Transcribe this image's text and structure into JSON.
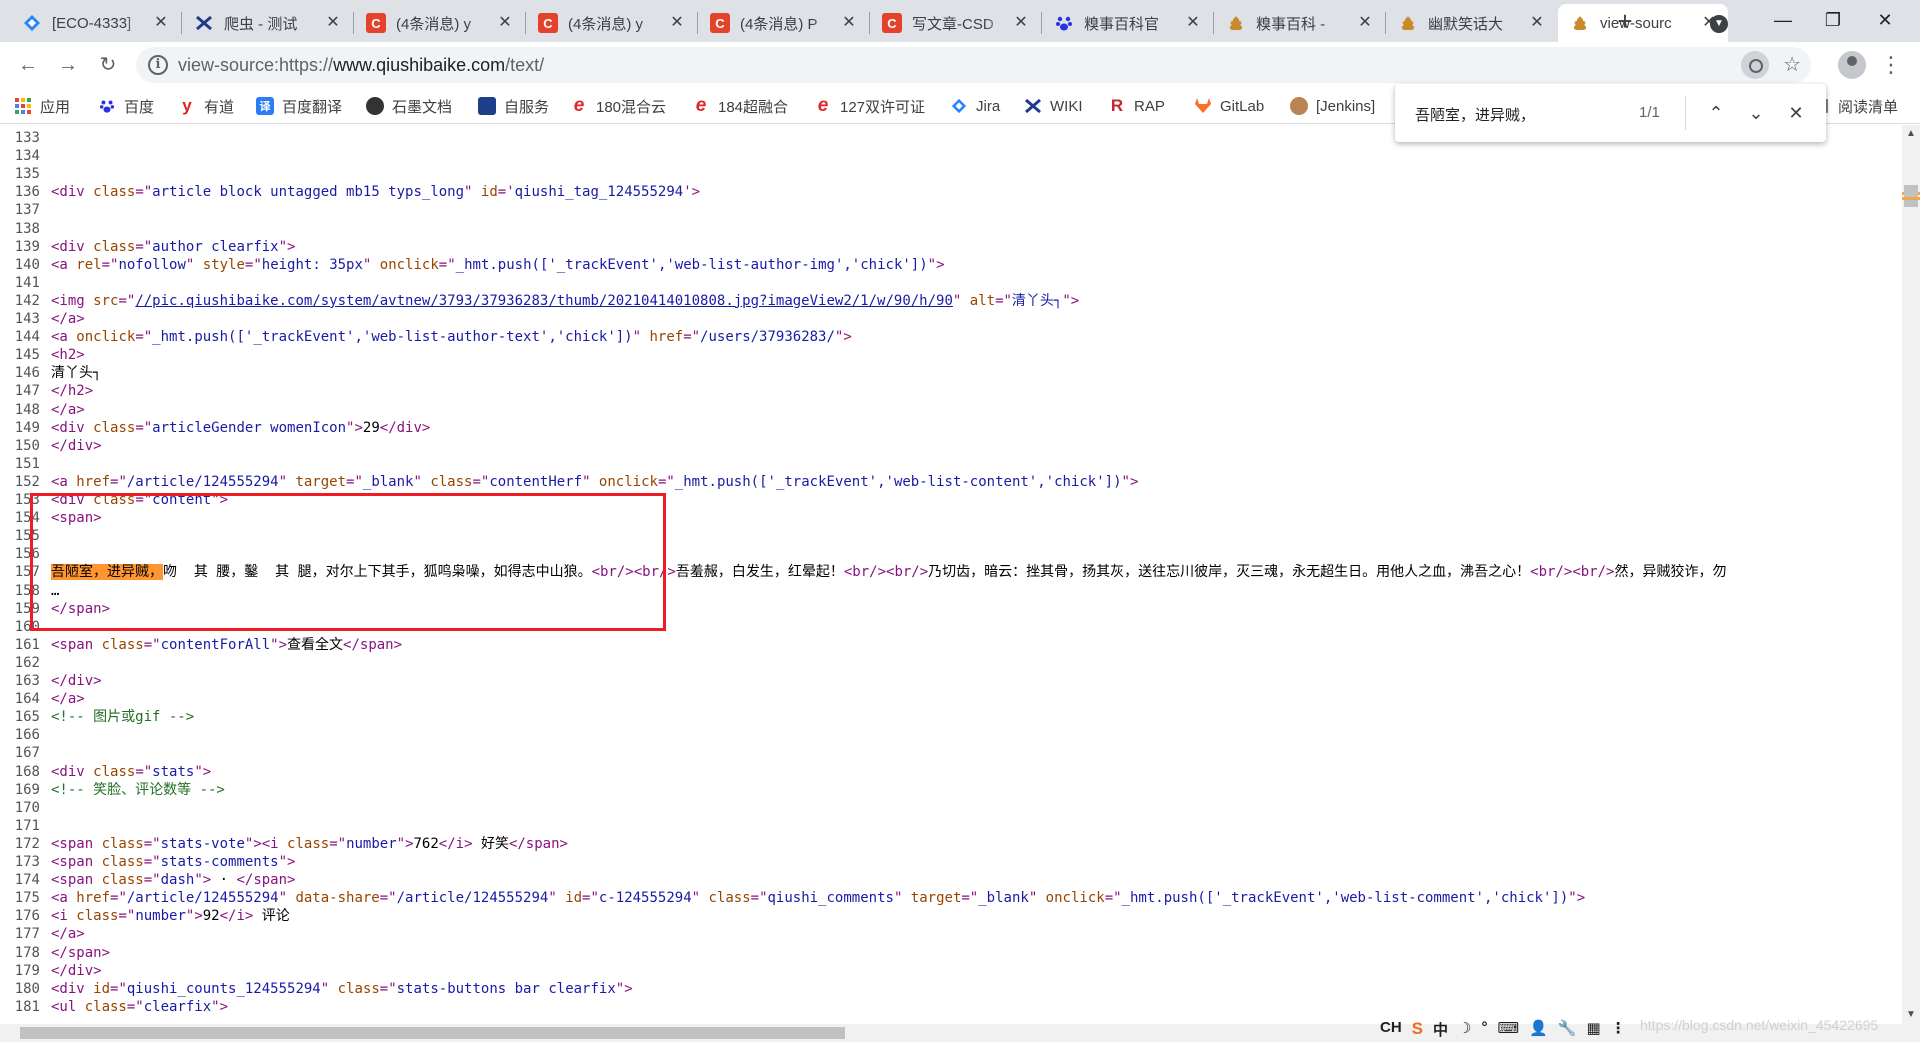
{
  "tabs": [
    {
      "title": "[ECO-4333]",
      "icon": "jira-diamond-icon",
      "color": "#2684ff"
    },
    {
      "title": "爬虫 - 测试",
      "icon": "crawler-x-icon",
      "color": "#1f3a8a"
    },
    {
      "title": "(4条消息) y",
      "icon": "csdn-c-icon",
      "color": "#e3422b"
    },
    {
      "title": "(4条消息) y",
      "icon": "csdn-c-icon",
      "color": "#e3422b"
    },
    {
      "title": "(4条消息) P",
      "icon": "csdn-c-icon",
      "color": "#e3422b"
    },
    {
      "title": "写文章-CSD",
      "icon": "csdn-c-icon",
      "color": "#e3422b"
    },
    {
      "title": "糗事百科官",
      "icon": "baidu-paw-icon",
      "color": "#2932e1"
    },
    {
      "title": "糗事百科 - ",
      "icon": "qiushi-poop-icon",
      "color": "#c98a2b"
    },
    {
      "title": "幽默笑话大",
      "icon": "qiushi-poop-icon",
      "color": "#c98a2b"
    },
    {
      "title": "view-sourc",
      "icon": "qiushi-poop-icon",
      "color": "#c98a2b",
      "active": true
    }
  ],
  "omnibox": {
    "prefix": "view-source:https://",
    "host": "www.qiushibaike.com",
    "path": "/text/"
  },
  "bookmarks": [
    {
      "label": "应用",
      "icon": "apps-grid-icon"
    },
    {
      "label": "百度",
      "icon": "baidu-paw-icon"
    },
    {
      "label": "有道",
      "icon": "youdao-y-icon"
    },
    {
      "label": "百度翻译",
      "icon": "baidu-translate-icon"
    },
    {
      "label": "石墨文档",
      "icon": "shimo-icon"
    },
    {
      "label": "自服务",
      "icon": "self-service-icon"
    },
    {
      "label": "180混合云",
      "icon": "cloud-e-icon"
    },
    {
      "label": "184超融合",
      "icon": "cloud-e-icon"
    },
    {
      "label": "127双许可证",
      "icon": "cloud-e-icon"
    },
    {
      "label": "Jira",
      "icon": "jira-diamond-icon"
    },
    {
      "label": "WIKI",
      "icon": "wiki-x-icon"
    },
    {
      "label": "RAP",
      "icon": "rap-r-icon"
    },
    {
      "label": "GitLab",
      "icon": "gitlab-fox-icon"
    },
    {
      "label": "[Jenkins]",
      "icon": "jenkins-icon"
    },
    {
      "label": "阅读清单",
      "icon": "reading-list-icon"
    }
  ],
  "find": {
    "query": "吾陋室，进异贼，",
    "count": "1/1"
  },
  "source": {
    "lines": [
      {
        "n": "133",
        "html": ""
      },
      {
        "n": "134",
        "html": ""
      },
      {
        "n": "135",
        "html": ""
      },
      {
        "n": "136",
        "html": "<span class='t'>&lt;div </span><span class='a'>class</span><span class='t'>=\"</span><span class='v'>article block untagged mb15 typs_long</span><span class='t'>\" </span><span class='a'>id</span><span class='t'>='</span><span class='v'>qiushi_tag_124555294</span><span class='t'>'&gt;</span>"
      },
      {
        "n": "137",
        "html": ""
      },
      {
        "n": "138",
        "html": ""
      },
      {
        "n": "139",
        "html": "<span class='t'>&lt;div </span><span class='a'>class</span><span class='t'>=\"</span><span class='v'>author clearfix</span><span class='t'>\"&gt;</span>"
      },
      {
        "n": "140",
        "html": "<span class='t'>&lt;a </span><span class='a'>rel</span><span class='t'>=\"</span><span class='v'>nofollow</span><span class='t'>\" </span><span class='a'>style</span><span class='t'>=\"</span><span class='v'>height: 35px</span><span class='t'>\" </span><span class='a'>onclick</span><span class='t'>=\"</span><span class='v'>_hmt.push(['_trackEvent','web-list-author-img','chick'])</span><span class='t'>\"&gt;</span>"
      },
      {
        "n": "141",
        "html": ""
      },
      {
        "n": "142",
        "html": "<span class='t'>&lt;img </span><span class='a'>src</span><span class='t'>=\"</span><span class='lnk'>//pic.qiushibaike.com/system/avtnew/3793/37936283/thumb/20210414010808.jpg?imageView2/1/w/90/h/90</span><span class='t'>\" </span><span class='a'>alt</span><span class='t'>=\"</span><span class='v'>清丫头┐</span><span class='t'>\"&gt;</span>"
      },
      {
        "n": "143",
        "html": "<span class='t'>&lt;/a&gt;</span>"
      },
      {
        "n": "144",
        "html": "<span class='t'>&lt;a </span><span class='a'>onclick</span><span class='t'>=\"</span><span class='v'>_hmt.push(['_trackEvent','web-list-author-text','chick'])</span><span class='t'>\" </span><span class='a'>href</span><span class='t'>=\"</span><span class='v'>/users/37936283/</span><span class='t'>\"&gt;</span>"
      },
      {
        "n": "145",
        "html": "<span class='t'>&lt;h2&gt;</span>"
      },
      {
        "n": "146",
        "html": "清丫头┐"
      },
      {
        "n": "147",
        "html": "<span class='t'>&lt;/h2&gt;</span>"
      },
      {
        "n": "148",
        "html": "<span class='t'>&lt;/a&gt;</span>"
      },
      {
        "n": "149",
        "html": "<span class='t'>&lt;div </span><span class='a'>class</span><span class='t'>=\"</span><span class='v'>articleGender womenIcon</span><span class='t'>\"&gt;</span>29<span class='t'>&lt;/div&gt;</span>"
      },
      {
        "n": "150",
        "html": "<span class='t'>&lt;/div&gt;</span>"
      },
      {
        "n": "151",
        "html": ""
      },
      {
        "n": "152",
        "html": "<span class='t'>&lt;a </span><span class='a'>href</span><span class='t'>=\"</span><span class='v'>/article/124555294</span><span class='t'>\" </span><span class='a'>target</span><span class='t'>=\"</span><span class='v'>_blank</span><span class='t'>\" </span><span class='a'>class</span><span class='t'>=\"</span><span class='v'>contentHerf</span><span class='t'>\" </span><span class='a'>onclick</span><span class='t'>=\"</span><span class='v'>_hmt.push(['_trackEvent','web-list-content','chick'])</span><span class='t'>\"&gt;</span>"
      },
      {
        "n": "153",
        "html": "<span class='t'>&lt;div </span><span class='a'>class</span><span class='t'>=\"</span><span class='v'>content</span><span class='t'>\"&gt;</span>"
      },
      {
        "n": "154",
        "html": "<span class='t'>&lt;span&gt;</span>"
      },
      {
        "n": "155",
        "html": ""
      },
      {
        "n": "156",
        "html": ""
      },
      {
        "n": "157",
        "html": "<span class='hl'>吾陋室，进异贼，</span>吻  其 腰，鑿  其 腿，对尔上下其手，狐鸣枭噪，如得志中山狼。<span class='t'>&lt;br/&gt;&lt;br/&gt;</span>吾羞赧，白发生，红晕起！<span class='t'>&lt;br/&gt;&lt;br/&gt;</span>乃切齿，暗云：挫其骨，扬其灰，送往忘川彼岸，灭三魂，永无超生日。用他人之血，沸吾之心！<span class='t'>&lt;br/&gt;&lt;br/&gt;</span>然，异贼狡诈，勿"
      },
      {
        "n": "158",
        "html": "…"
      },
      {
        "n": "159",
        "html": "<span class='t'>&lt;/span&gt;</span>"
      },
      {
        "n": "160",
        "html": ""
      },
      {
        "n": "161",
        "html": "<span class='t'>&lt;span </span><span class='a'>class</span><span class='t'>=\"</span><span class='v'>contentForAll</span><span class='t'>\"&gt;</span>查看全文<span class='t'>&lt;/span&gt;</span>"
      },
      {
        "n": "162",
        "html": ""
      },
      {
        "n": "163",
        "html": "<span class='t'>&lt;/div&gt;</span>"
      },
      {
        "n": "164",
        "html": "<span class='t'>&lt;/a&gt;</span>"
      },
      {
        "n": "165",
        "html": "<span class='cm'>&lt;!-- 图片或gif --&gt;</span>"
      },
      {
        "n": "166",
        "html": ""
      },
      {
        "n": "167",
        "html": ""
      },
      {
        "n": "168",
        "html": "<span class='t'>&lt;div </span><span class='a'>class</span><span class='t'>=\"</span><span class='v'>stats</span><span class='t'>\"&gt;</span>"
      },
      {
        "n": "169",
        "html": "<span class='cm'>&lt;!-- 笑脸、评论数等 --&gt;</span>"
      },
      {
        "n": "170",
        "html": ""
      },
      {
        "n": "171",
        "html": ""
      },
      {
        "n": "172",
        "html": "<span class='t'>&lt;span </span><span class='a'>class</span><span class='t'>=\"</span><span class='v'>stats-vote</span><span class='t'>\"&gt;&lt;i </span><span class='a'>class</span><span class='t'>=\"</span><span class='v'>number</span><span class='t'>\"&gt;</span>762<span class='t'>&lt;/i&gt;</span> 好笑<span class='t'>&lt;/span&gt;</span>"
      },
      {
        "n": "173",
        "html": "<span class='t'>&lt;span </span><span class='a'>class</span><span class='t'>=\"</span><span class='v'>stats-comments</span><span class='t'>\"&gt;</span>"
      },
      {
        "n": "174",
        "html": "<span class='t'>&lt;span </span><span class='a'>class</span><span class='t'>=\"</span><span class='v'>dash</span><span class='t'>\"&gt;</span> · <span class='t'>&lt;/span&gt;</span>"
      },
      {
        "n": "175",
        "html": "<span class='t'>&lt;a </span><span class='a'>href</span><span class='t'>=\"</span><span class='v'>/article/124555294</span><span class='t'>\" </span><span class='a'>data-share</span><span class='t'>=\"</span><span class='v'>/article/124555294</span><span class='t'>\" </span><span class='a'>id</span><span class='t'>=\"</span><span class='v'>c-124555294</span><span class='t'>\" </span><span class='a'>class</span><span class='t'>=\"</span><span class='v'>qiushi_comments</span><span class='t'>\" </span><span class='a'>target</span><span class='t'>=\"</span><span class='v'>_blank</span><span class='t'>\" </span><span class='a'>onclick</span><span class='t'>=\"</span><span class='v'>_hmt.push(['_trackEvent','web-list-comment','chick'])</span><span class='t'>\"&gt;</span>"
      },
      {
        "n": "176",
        "html": "<span class='t'>&lt;i </span><span class='a'>class</span><span class='t'>=\"</span><span class='v'>number</span><span class='t'>\"&gt;</span>92<span class='t'>&lt;/i&gt;</span> 评论"
      },
      {
        "n": "177",
        "html": "<span class='t'>&lt;/a&gt;</span>"
      },
      {
        "n": "178",
        "html": "<span class='t'>&lt;/span&gt;</span>"
      },
      {
        "n": "179",
        "html": "<span class='t'>&lt;/div&gt;</span>"
      },
      {
        "n": "180",
        "html": "<span class='t'>&lt;div </span><span class='a'>id</span><span class='t'>=\"</span><span class='v'>qiushi_counts_124555294</span><span class='t'>\" </span><span class='a'>class</span><span class='t'>=\"</span><span class='v'>stats-buttons bar clearfix</span><span class='t'>\"&gt;</span>"
      },
      {
        "n": "181",
        "html": "<span class='t'>&lt;ul </span><span class='a'>class</span><span class='t'>=\"</span><span class='v'>clearfix</span><span class='t'>\"&gt;</span>"
      }
    ]
  },
  "ime": {
    "items": [
      "CH",
      "S",
      "中",
      "☽",
      "°",
      "⌨",
      "👤",
      "🔧",
      "▦",
      "⋮"
    ]
  },
  "watermark": "https://blog.csdn.net/weixin_45422695"
}
